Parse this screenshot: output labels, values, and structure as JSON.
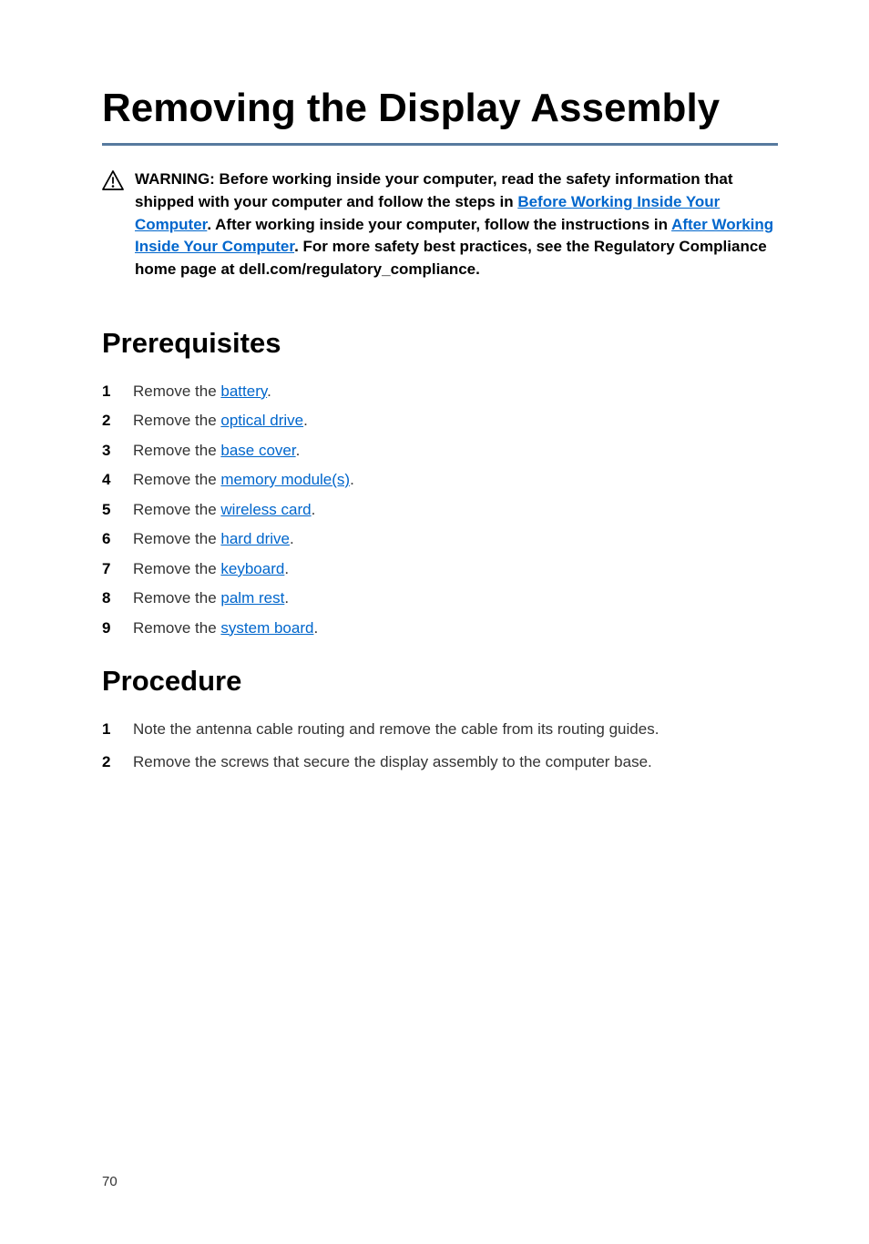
{
  "title": "Removing the Display Assembly",
  "warning": {
    "prefix": "WARNING: Before working inside your computer, read the safety information that shipped with your computer and follow the steps in ",
    "link1": "Before Working Inside Your Computer",
    "mid1": ". After working inside your computer, follow the instructions in ",
    "link2": "After Working Inside Your Computer",
    "suffix": ". For more safety best practices, see the Regulatory Compliance home page at dell.com/regulatory_compliance."
  },
  "sections": {
    "prerequisites": {
      "heading": "Prerequisites",
      "items": [
        {
          "num": "1",
          "prefix": "Remove the ",
          "link": "battery",
          "suffix": "."
        },
        {
          "num": "2",
          "prefix": "Remove the ",
          "link": "optical drive",
          "suffix": "."
        },
        {
          "num": "3",
          "prefix": "Remove the ",
          "link": "base cover",
          "suffix": "."
        },
        {
          "num": "4",
          "prefix": "Remove the ",
          "link": "memory module(s)",
          "suffix": "."
        },
        {
          "num": "5",
          "prefix": "Remove the ",
          "link": "wireless card",
          "suffix": "."
        },
        {
          "num": "6",
          "prefix": "Remove the ",
          "link": "hard drive",
          "suffix": "."
        },
        {
          "num": "7",
          "prefix": "Remove the ",
          "link": "keyboard",
          "suffix": "."
        },
        {
          "num": "8",
          "prefix": "Remove the ",
          "link": "palm rest",
          "suffix": "."
        },
        {
          "num": "9",
          "prefix": "Remove the ",
          "link": "system board",
          "suffix": "."
        }
      ]
    },
    "procedure": {
      "heading": "Procedure",
      "items": [
        {
          "num": "1",
          "text": "Note the antenna cable routing and remove the cable from its routing guides."
        },
        {
          "num": "2",
          "text": "Remove the screws that secure the display assembly to the computer base."
        }
      ]
    }
  },
  "pageNumber": "70"
}
